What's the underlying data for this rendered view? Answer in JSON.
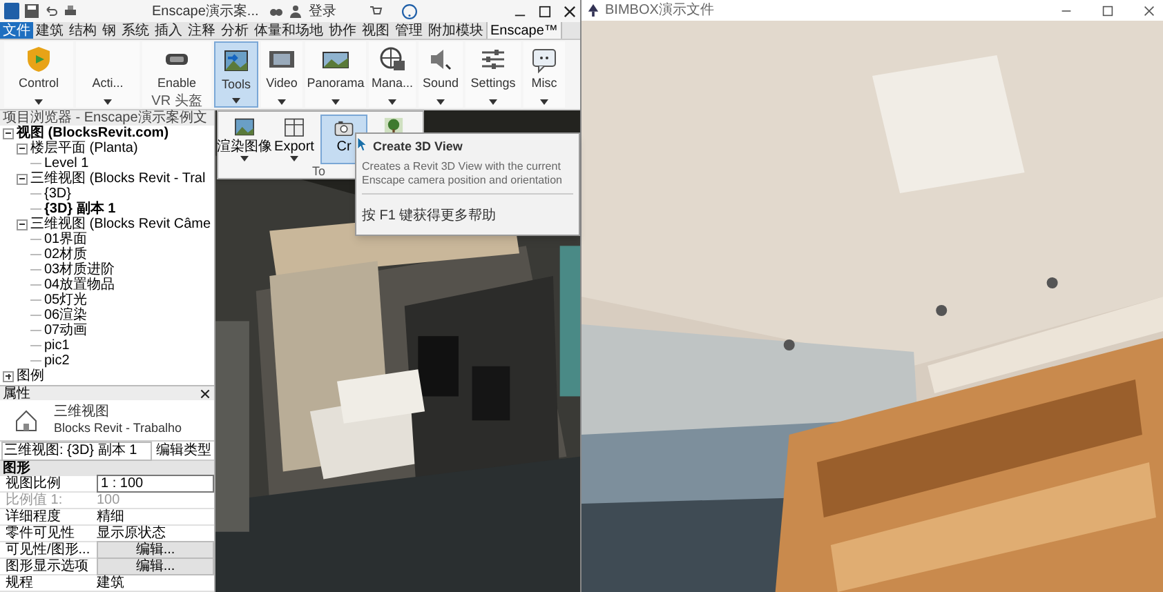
{
  "quick_access": {
    "document_title": "Enscape演示案...",
    "sign_in": "登录"
  },
  "ribbon_tabs": [
    {
      "label": "文件",
      "kind": "file",
      "selected": false
    },
    {
      "label": "建筑",
      "kind": "tab",
      "selected": false
    },
    {
      "label": "结构",
      "kind": "tab",
      "selected": false
    },
    {
      "label": "钢",
      "kind": "tab",
      "selected": false
    },
    {
      "label": "系统",
      "kind": "tab",
      "selected": false
    },
    {
      "label": "插入",
      "kind": "tab",
      "selected": false
    },
    {
      "label": "注释",
      "kind": "tab",
      "selected": false
    },
    {
      "label": "分析",
      "kind": "tab",
      "selected": false
    },
    {
      "label": "体量和场地",
      "kind": "tab",
      "selected": false
    },
    {
      "label": "协作",
      "kind": "tab",
      "selected": false
    },
    {
      "label": "视图",
      "kind": "tab",
      "selected": false
    },
    {
      "label": "管理",
      "kind": "tab",
      "selected": false
    },
    {
      "label": "附加模块",
      "kind": "tab",
      "selected": false
    },
    {
      "label": "Enscape™",
      "kind": "tab",
      "selected": true
    }
  ],
  "ribbon_buttons": [
    {
      "label": "Control",
      "selected": false,
      "has_menu": true
    },
    {
      "label": "Acti...",
      "selected": false,
      "has_menu": true
    },
    {
      "label": "Enable",
      "selected": false,
      "panel_label": "VR 头盔"
    },
    {
      "label": "Tools",
      "selected": true,
      "has_menu": true
    },
    {
      "label": "Video",
      "selected": false,
      "has_menu": true
    },
    {
      "label": "Panorama",
      "selected": false,
      "has_menu": true
    },
    {
      "label": "Mana...",
      "selected": false,
      "has_menu": true
    },
    {
      "label": "Sound",
      "selected": false,
      "has_menu": true
    },
    {
      "label": "Settings",
      "selected": false,
      "has_menu": true
    },
    {
      "label": "Misc",
      "selected": false,
      "has_menu": true
    }
  ],
  "tools_menu": {
    "panel_label": "To",
    "items": [
      {
        "label": "渲染图像",
        "selected": false,
        "has_menu": true
      },
      {
        "label": "Export",
        "selected": false,
        "has_menu": true
      },
      {
        "label": "Cr",
        "selected": true
      },
      {
        "selected": false
      }
    ]
  },
  "tooltip": {
    "title": "Create 3D View",
    "description": "Creates a Revit 3D View with the current Enscape camera position and orientation",
    "help": "按 F1 键获得更多帮助"
  },
  "project_browser": {
    "title": "项目浏览器 - Enscape演示案例文",
    "tree": [
      {
        "label": "视图 (BlocksRevit.com)",
        "current": true,
        "expanded": true,
        "children": [
          {
            "label": "楼层平面 (Planta)",
            "current": false,
            "expanded": true,
            "children": [
              {
                "label": "Level 1",
                "current": false
              }
            ]
          },
          {
            "label": "三维视图 (Blocks Revit - Tral",
            "current": false,
            "expanded": true,
            "children": [
              {
                "label": "{3D}",
                "current": false
              },
              {
                "label": "{3D} 副本 1",
                "current": true
              }
            ]
          },
          {
            "label": "三维视图 (Blocks Revit Câme",
            "current": false,
            "expanded": true,
            "children": [
              {
                "label": "01界面",
                "current": false
              },
              {
                "label": "02材质",
                "current": false
              },
              {
                "label": "03材质进阶",
                "current": false
              },
              {
                "label": "04放置物品",
                "current": false
              },
              {
                "label": "05灯光",
                "current": false
              },
              {
                "label": "06渲染",
                "current": false
              },
              {
                "label": "07动画",
                "current": false
              },
              {
                "label": "pic1",
                "current": false
              },
              {
                "label": "pic2",
                "current": false
              }
            ]
          }
        ]
      },
      {
        "label": "图例",
        "current": false,
        "expanded": false
      }
    ]
  },
  "properties": {
    "title": "属性",
    "type_category": "三维视图",
    "type_name": "Blocks Revit - Trabalho",
    "view_selector": "三维视图: {3D} 副本 1",
    "edit_type": "编辑类型",
    "group": "图形",
    "rows": [
      {
        "label": "视图比例",
        "value": "1 : 100",
        "kind": "input",
        "disabled": false
      },
      {
        "label": "比例值 1:",
        "value": "100",
        "kind": "text",
        "disabled": true
      },
      {
        "label": "详细程度",
        "value": "精细",
        "kind": "text",
        "disabled": false
      },
      {
        "label": "零件可见性",
        "value": "显示原状态",
        "kind": "text",
        "disabled": false
      },
      {
        "label": "可见性/图形...",
        "value": "编辑...",
        "kind": "button",
        "disabled": false
      },
      {
        "label": "图形显示选项",
        "value": "编辑...",
        "kind": "button",
        "disabled": false
      },
      {
        "label": "规程",
        "value": "建筑",
        "kind": "text",
        "disabled": false
      }
    ]
  },
  "viewer_window": {
    "title": "BIMBOX演示文件"
  }
}
